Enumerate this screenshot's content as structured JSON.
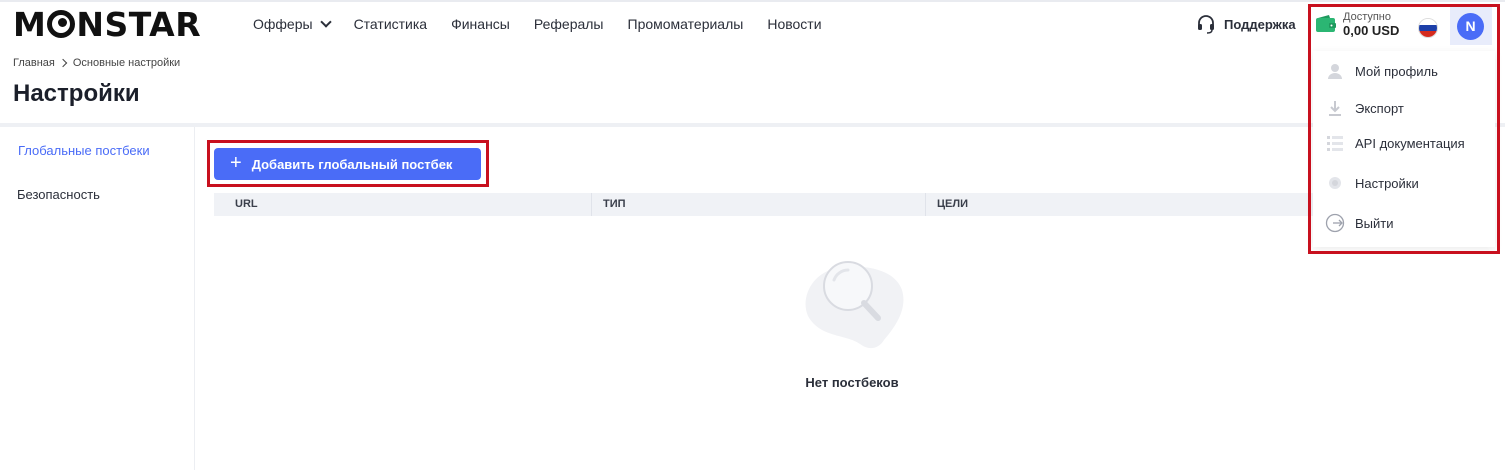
{
  "header": {
    "logo": {
      "prefix": "M",
      "suffix": "NSTAR"
    },
    "nav": [
      {
        "label": "Офферы",
        "has_dropdown": true
      },
      {
        "label": "Статистика"
      },
      {
        "label": "Финансы"
      },
      {
        "label": "Рефералы"
      },
      {
        "label": "Промоматериалы"
      },
      {
        "label": "Новости"
      }
    ],
    "support_label": "Поддержка",
    "balance": {
      "label": "Доступно",
      "value": "0,00 USD"
    },
    "avatar_initial": "N"
  },
  "breadcrumb": {
    "home": "Главная",
    "current": "Основные настройки"
  },
  "page_title": "Настройки",
  "sidebar": {
    "items": [
      {
        "label": "Глобальные постбеки",
        "active": true
      },
      {
        "label": "Безопасность",
        "active": false
      }
    ]
  },
  "main": {
    "add_button_label": "Добавить глобальный постбек",
    "table": {
      "columns": [
        "URL",
        "ТИП",
        "ЦЕЛИ"
      ]
    },
    "empty_text": "Нет постбеков"
  },
  "dropdown": {
    "items": [
      {
        "label": "Мой профиль",
        "icon": "user-icon"
      },
      {
        "label": "Экспорт",
        "icon": "download-icon"
      },
      {
        "label": "API документация",
        "icon": "list-icon"
      },
      {
        "label": "Настройки",
        "icon": "gear-icon"
      },
      {
        "label": "Выйти",
        "icon": "logout-icon"
      }
    ]
  },
  "colors": {
    "accent": "#4a6cf7",
    "highlight": "#c8101e",
    "wallet": "#2bb673"
  }
}
